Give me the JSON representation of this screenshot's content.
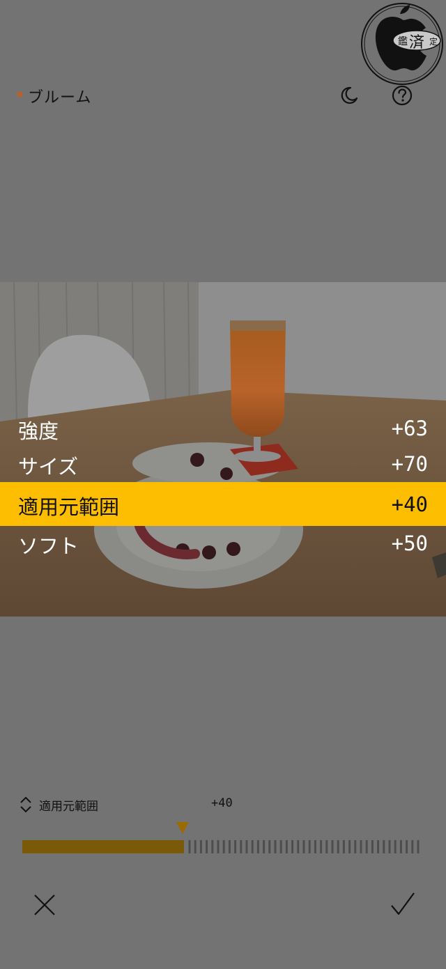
{
  "header": {
    "title": "ブルーム",
    "moon_icon": "moon-icon",
    "help_icon": "help-icon",
    "accent_color": "#b8612b"
  },
  "stamp": {
    "text_left": "鑑",
    "text_center": "済",
    "text_right": "定"
  },
  "adjustments": [
    {
      "label": "強度",
      "value": "+63"
    },
    {
      "label": "サイズ",
      "value": "+70"
    },
    {
      "label": "適用元範囲",
      "value": "+40"
    },
    {
      "label": "ソフト",
      "value": "+50"
    }
  ],
  "active_adjustment_index": 2,
  "highlight_color": "#fdbd00",
  "slider": {
    "label": "適用元範囲",
    "value": "+40",
    "level": 0.4
  },
  "footer": {
    "cancel_icon": "close-icon",
    "confirm_icon": "checkmark-icon"
  }
}
